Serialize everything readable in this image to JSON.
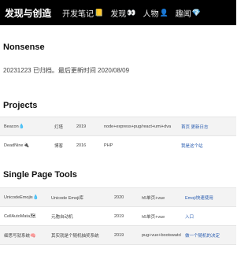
{
  "header": {
    "brand": "发现与创造",
    "nav": [
      {
        "label": "开发笔记",
        "icon": "notebook-icon",
        "glyph": "📒"
      },
      {
        "label": "发现",
        "icon": "eyes-icon",
        "glyph": "👀"
      },
      {
        "label": "人物",
        "icon": "person-icon",
        "glyph": "👤"
      },
      {
        "label": "趣闻",
        "icon": "gem-icon",
        "glyph": "💎"
      }
    ]
  },
  "page": {
    "title": "Nonsense",
    "notice": "20231223 已归档。最后更新时间 2020/08/09"
  },
  "projects": {
    "title": "Projects",
    "rows": [
      {
        "name": "Beacon",
        "glyph": "💧",
        "type": "灯塔",
        "year": "2019",
        "stack": "node+express+pug/react+umi+dva",
        "link": "首页 更新日志"
      },
      {
        "name": "DeadNine",
        "glyph": "🔌",
        "type": "博客",
        "year": "2016",
        "stack": "PHP",
        "link": "我是这个站"
      }
    ]
  },
  "single_page_tools": {
    "title": "Single Page Tools",
    "rows": [
      {
        "name": "UnicodeEmojis",
        "glyph": "💧",
        "desc": "Unicode Emoji库",
        "year": "2020",
        "stack": "h5单页+vue",
        "link": "Emoji快速使用"
      },
      {
        "name": "CellAutoMata",
        "glyph": "🗺",
        "desc": "元胞自动机",
        "year": "2019",
        "stack": "h5单页+vue",
        "link": "入口"
      },
      {
        "name": "细思写就系统",
        "glyph": "🧠",
        "desc": "其实就是个随机抽奖系统",
        "year": "2019",
        "stack": "pug+vue+bootswatch",
        "link": "做一个随机的决定"
      },
      {
        "name": "",
        "glyph": "",
        "desc": "",
        "year": "",
        "stack": "",
        "link": ""
      }
    ]
  }
}
